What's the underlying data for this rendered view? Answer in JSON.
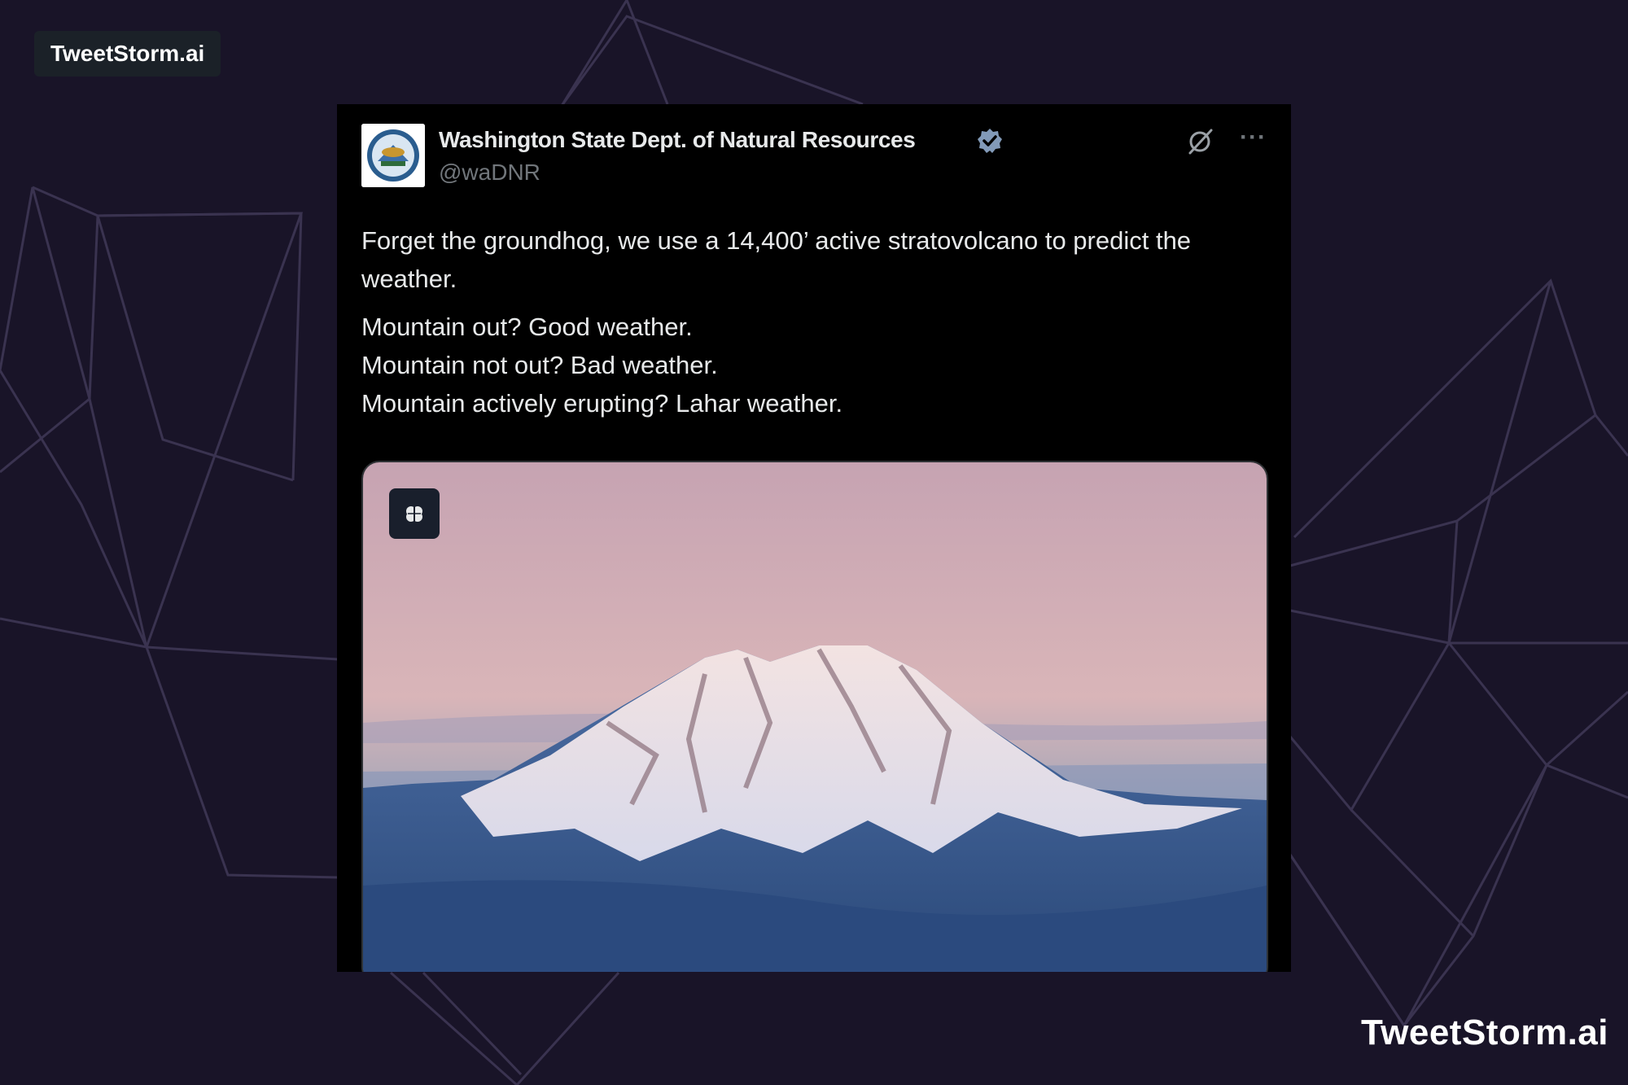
{
  "watermark_top": "TweetStorm.ai",
  "watermark_bottom": "TweetStorm.ai",
  "tweet": {
    "author_name": "Washington State Dept. of Natural Resources",
    "handle": "@waDNR",
    "text_lines": [
      "Forget the groundhog, we use a 14,400’ active stratovolcano to predict the weather.",
      "Mountain out? Good weather.",
      "Mountain not out? Bad weather.",
      "Mountain actively erupting? Lahar weather."
    ],
    "image_alt": "Snow-capped Mount Rainier above the clouds",
    "icons": {
      "verified": "verified-badge-icon",
      "grok": "grok-icon",
      "more": "more-options-icon",
      "media_badge": "brain-icon"
    }
  },
  "colors": {
    "background": "#191428",
    "card": "#000000",
    "text": "#e7e9ea",
    "muted": "#71767b",
    "verified": "#829ab8"
  }
}
